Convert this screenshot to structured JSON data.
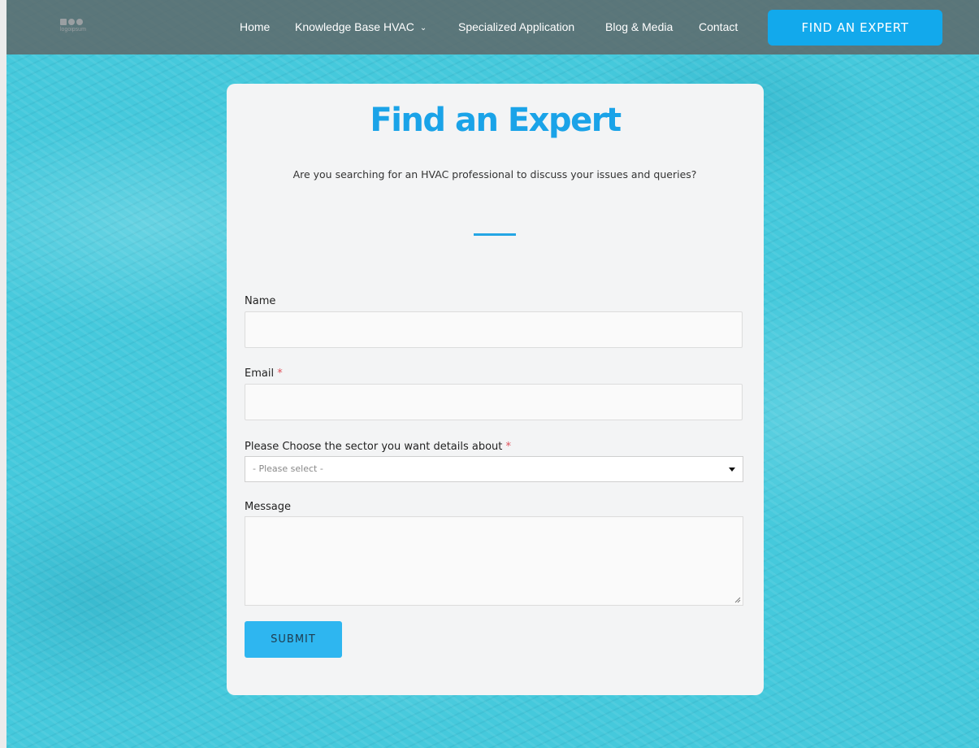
{
  "header": {
    "logo_text": "logoipsum",
    "nav": [
      {
        "label": "Home"
      },
      {
        "label": "Knowledge Base HVAC"
      },
      {
        "label": "Specialized Application"
      },
      {
        "label": "Blog & Media"
      },
      {
        "label": "Contact"
      }
    ],
    "cta_label": "FIND AN EXPERT"
  },
  "form_card": {
    "title": "Find an Expert",
    "subtitle": "Are you searching for an HVAC professional to discuss your issues and queries?",
    "fields": {
      "name": {
        "label": "Name",
        "value": ""
      },
      "email": {
        "label": "Email",
        "required_mark": "*",
        "value": ""
      },
      "sector": {
        "label": "Please Choose the sector you want details about",
        "required_mark": "*",
        "selected": "- Please select -"
      },
      "message": {
        "label": "Message",
        "value": ""
      }
    },
    "submit_label": "SUBMIT"
  },
  "colors": {
    "accent": "#1aa3e8",
    "cta": "#12a9ec",
    "header_bg": "rgba(95,100,100,0.82)",
    "background": "#45c9dc",
    "required": "#e0505a"
  },
  "icons": {
    "dropdown": "chevron-down-icon",
    "select_caret": "caret-down-icon",
    "resize": "resize-grip-icon"
  }
}
